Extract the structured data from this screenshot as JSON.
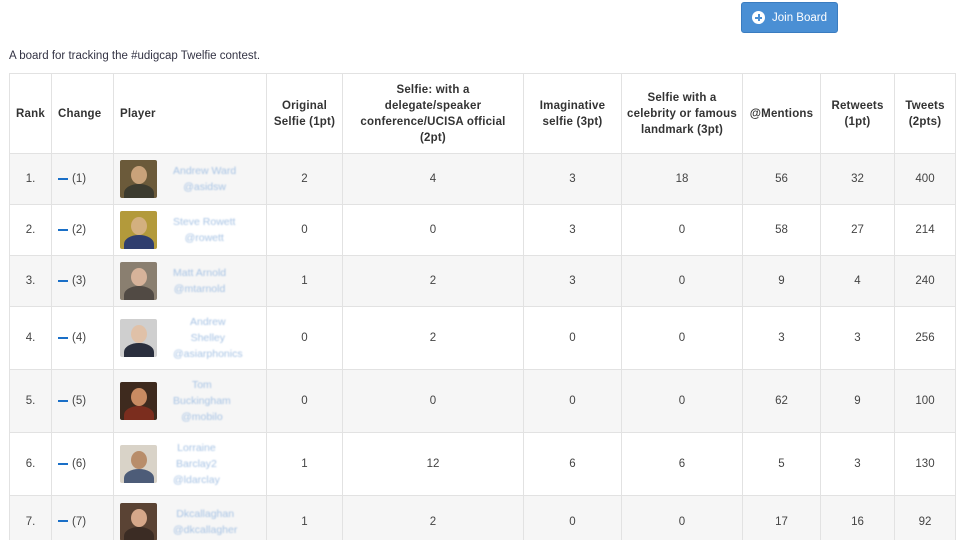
{
  "header": {
    "join_button_label": "Join Board",
    "description": "A board for tracking the #udigcap Twelfie contest."
  },
  "table": {
    "columns": [
      "Rank",
      "Change",
      "Player",
      "Original Selfie (1pt)",
      "Selfie: with a delegate/speaker conference/UCISA official (2pt)",
      "Imaginative selfie (3pt)",
      "Selfie with a celebrity or famous landmark (3pt)",
      "@Mentions",
      "Retweets (1pt)",
      "Tweets (2pts)"
    ],
    "rows": [
      {
        "rank": "1.",
        "change": "(1)",
        "name": "Andrew Ward\n@asidsw",
        "original": "2",
        "delegate": "4",
        "imaginative": "3",
        "celebrity": "18",
        "mentions": "56",
        "retweets": "32",
        "tweets": "400",
        "row_height": 51
      },
      {
        "rank": "2.",
        "change": "(2)",
        "name": "Steve Rowett\n@rowett",
        "original": "0",
        "delegate": "0",
        "imaginative": "3",
        "celebrity": "0",
        "mentions": "58",
        "retweets": "27",
        "tweets": "214",
        "row_height": 51
      },
      {
        "rank": "3.",
        "change": "(3)",
        "name": "Matt Arnold\n@mtarnold",
        "original": "1",
        "delegate": "2",
        "imaginative": "3",
        "celebrity": "0",
        "mentions": "9",
        "retweets": "4",
        "tweets": "240",
        "row_height": 51
      },
      {
        "rank": "4.",
        "change": "(4)",
        "name": "Andrew\nShelley\n@asiarphonics",
        "original": "0",
        "delegate": "2",
        "imaginative": "0",
        "celebrity": "0",
        "mentions": "3",
        "retweets": "3",
        "tweets": "256",
        "row_height": 63
      },
      {
        "rank": "5.",
        "change": "(5)",
        "name": "Tom\nBuckingham\n@mobilo",
        "original": "0",
        "delegate": "0",
        "imaginative": "0",
        "celebrity": "0",
        "mentions": "62",
        "retweets": "9",
        "tweets": "100",
        "row_height": 63
      },
      {
        "rank": "6.",
        "change": "(6)",
        "name": "Lorraine\nBarclay2\n@ldarclay",
        "original": "1",
        "delegate": "12",
        "imaginative": "6",
        "celebrity": "6",
        "mentions": "5",
        "retweets": "3",
        "tweets": "130",
        "row_height": 63
      },
      {
        "rank": "7.",
        "change": "(7)",
        "name": "Dkcallaghan\n@dkcallagher",
        "original": "1",
        "delegate": "2",
        "imaginative": "0",
        "celebrity": "0",
        "mentions": "17",
        "retweets": "16",
        "tweets": "92",
        "row_height": 52
      }
    ]
  },
  "colors": {
    "accent": "#4a8fd4",
    "change_dash": "#1a6fc7",
    "player_link": "#a7c3e4",
    "row_stripe": "#f6f6f6"
  },
  "icons": {
    "join_button_icon": "plus-circle-icon"
  }
}
